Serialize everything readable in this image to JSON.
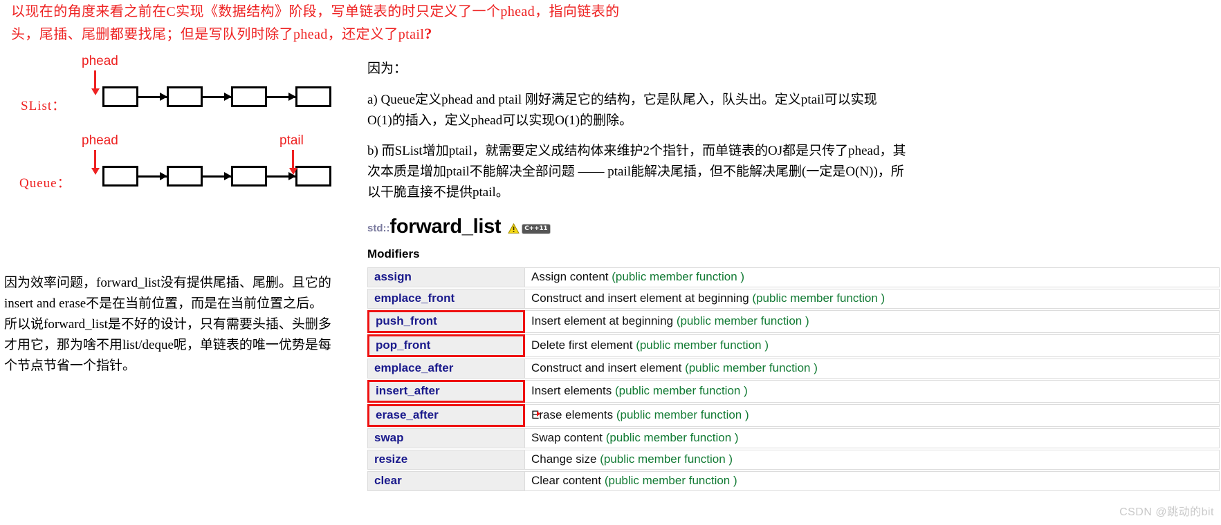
{
  "note_top": {
    "line1": "以现在的角度来看之前在C实现《数据结构》阶段，写单链表的时只定义了一个phead，指向链表的",
    "line2_a": "头，尾插、尾删都要找尾；但是写队列时除了phead，还定义了ptail",
    "line2_q": "?"
  },
  "diagram": {
    "slist_label": "SList：",
    "queue_label": "Queue：",
    "slist_phead": "phead",
    "queue_phead": "phead",
    "queue_ptail": "ptail",
    "node_count": 4,
    "arrow_color": "#ee2222",
    "node_border_color": "#000000"
  },
  "note_left": {
    "line1": "因为效率问题，forward_list没有提供尾插、尾删。且它的",
    "line2": "insert and erase不是在当前位置，而是在当前位置之后。",
    "line3": "所以说forward_list是不好的设计，只有需要头插、头删多",
    "line4": "才用它，那为啥不用list/deque呢，单链表的唯一优势是每",
    "line5": "个节点节省一个指针。"
  },
  "right": {
    "heading": "因为：",
    "para_a_line1": "a) Queue定义phead and ptail 刚好满足它的结构，它是队尾入，队头出。定义ptail可以实现",
    "para_a_line2": "O(1)的插入，定义phead可以实现O(1)的删除。",
    "para_b_line1": "b) 而SList增加ptail，就需要定义成结构体来维护2个指针，而单链表的OJ都是只传了phead，其",
    "para_b_line2": "次本质是增加ptail不能解决全部问题 —— ptail能解决尾插，但不能解决尾删(一定是O(N))，所",
    "para_b_line3": "以干脆直接不提供ptail。"
  },
  "api": {
    "namespace": "std::",
    "name": "forward_list",
    "badge_label": "C++11",
    "badge_icon": "warning-triangle-icon",
    "section_title": "Modifiers",
    "link_color": "#1a1a8c",
    "paren_color": "#117a33",
    "highlight_color": "#ee1111",
    "rows": [
      {
        "name": "assign",
        "desc": "Assign content ",
        "paren": "(public member function )",
        "highlight": false
      },
      {
        "name": "emplace_front",
        "desc": "Construct and insert element at beginning ",
        "paren": "(public member function )",
        "highlight": false
      },
      {
        "name": "push_front",
        "desc": "Insert element at beginning ",
        "paren": "(public member function )",
        "highlight": true
      },
      {
        "name": "pop_front",
        "desc": "Delete first element ",
        "paren": "(public member function )",
        "highlight": true
      },
      {
        "name": "emplace_after",
        "desc": "Construct and insert element ",
        "paren": "(public member function )",
        "highlight": false
      },
      {
        "name": "insert_after",
        "desc": "Insert elements ",
        "paren": "(public member function )",
        "highlight": true
      },
      {
        "name": "erase_after",
        "desc": "Erase elements ",
        "paren": "(public member function )",
        "highlight": true
      },
      {
        "name": "swap",
        "desc": "Swap content ",
        "paren": "(public member function )",
        "highlight": false
      },
      {
        "name": "resize",
        "desc": "Change size ",
        "paren": "(public member function )",
        "highlight": false
      },
      {
        "name": "clear",
        "desc": "Clear content ",
        "paren": "(public member function )",
        "highlight": false
      }
    ]
  },
  "watermark": "CSDN @跳动的bit"
}
